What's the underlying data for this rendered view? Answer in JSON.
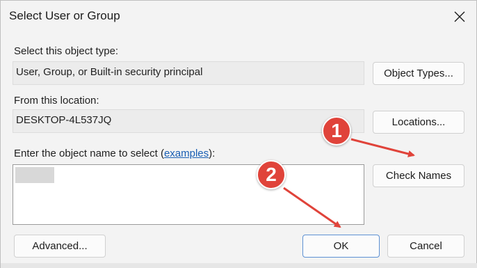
{
  "window": {
    "title": "Select User or Group"
  },
  "object_type": {
    "label": "Select this object type:",
    "value": "User, Group, or Built-in security principal",
    "button": "Object Types..."
  },
  "location": {
    "label": "From this location:",
    "value": "DESKTOP-4L537JQ",
    "button": "Locations..."
  },
  "object_name": {
    "label_prefix": "Enter the object name to select (",
    "link": "examples",
    "label_suffix": "):",
    "check_button": "Check Names"
  },
  "footer": {
    "advanced_button": "Advanced...",
    "ok_button": "OK",
    "cancel_button": "Cancel"
  },
  "annotations": {
    "callout_1": "1",
    "callout_2": "2",
    "color": "#e0433a"
  },
  "icons": {
    "close": "close-icon"
  }
}
